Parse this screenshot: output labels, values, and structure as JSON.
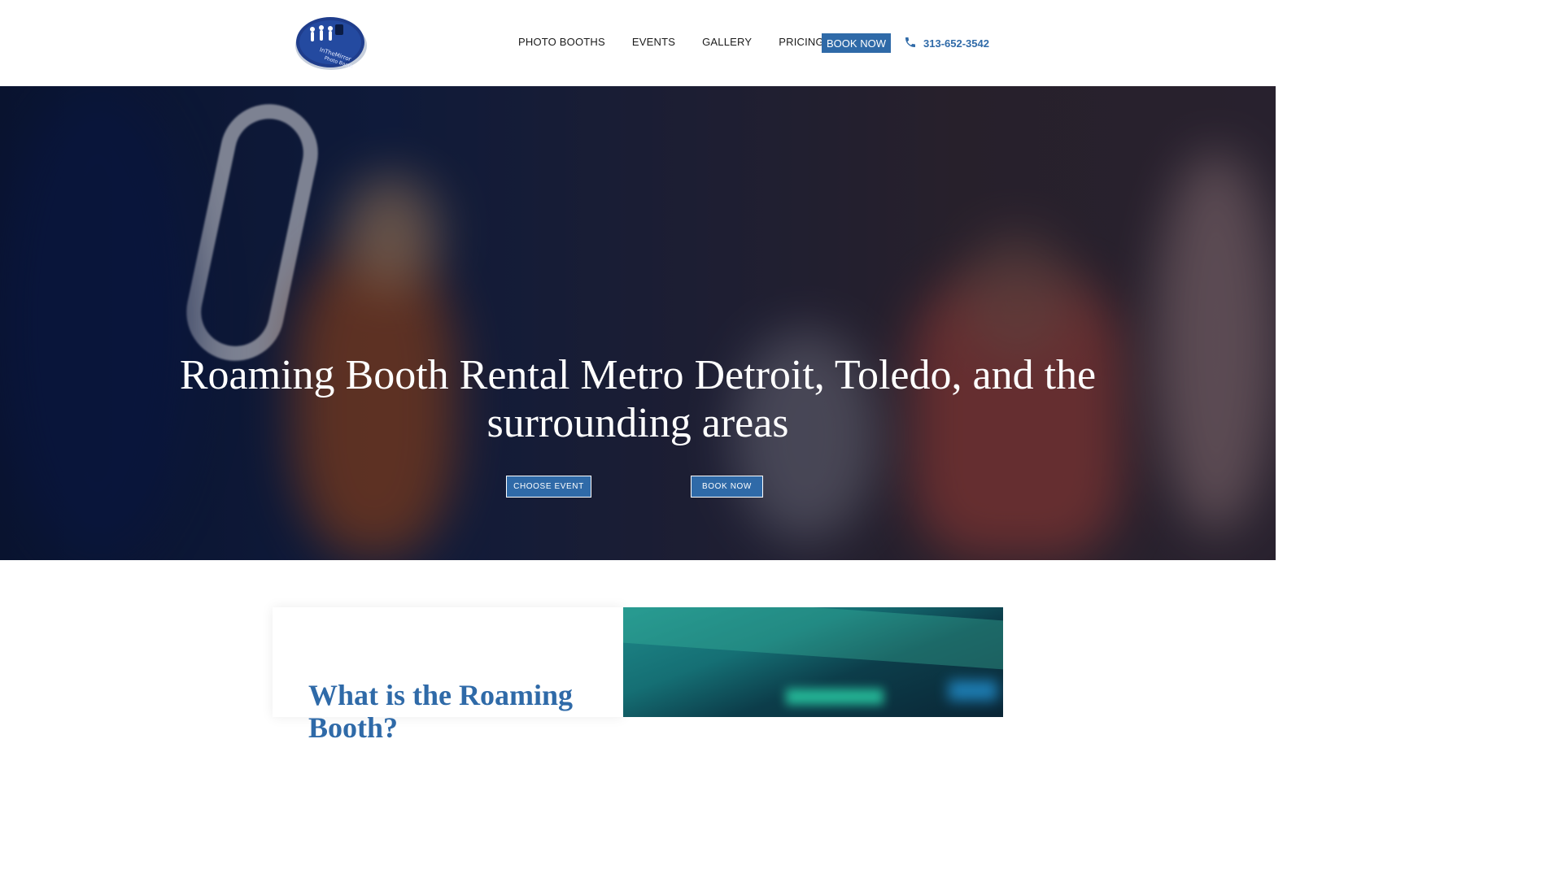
{
  "header": {
    "logo_alt": "InTheMirror Photo Booth",
    "nav": [
      "PHOTO BOOTHS",
      "EVENTS",
      "GALLERY",
      "PRICING"
    ],
    "book_now": "BOOK NOW",
    "phone": "313-652-3542",
    "phone_icon": "phone-icon"
  },
  "hero": {
    "title": "Roaming Booth Rental Metro Detroit, Toledo, and the surrounding areas",
    "buttons": {
      "choose_event": "CHOOSE EVENT",
      "book_now": "BOOK NOW"
    }
  },
  "info": {
    "title": "What is the Roaming Booth?"
  },
  "colors": {
    "accent": "#2f6aa8",
    "hero_dark": "#0c1a3a"
  }
}
